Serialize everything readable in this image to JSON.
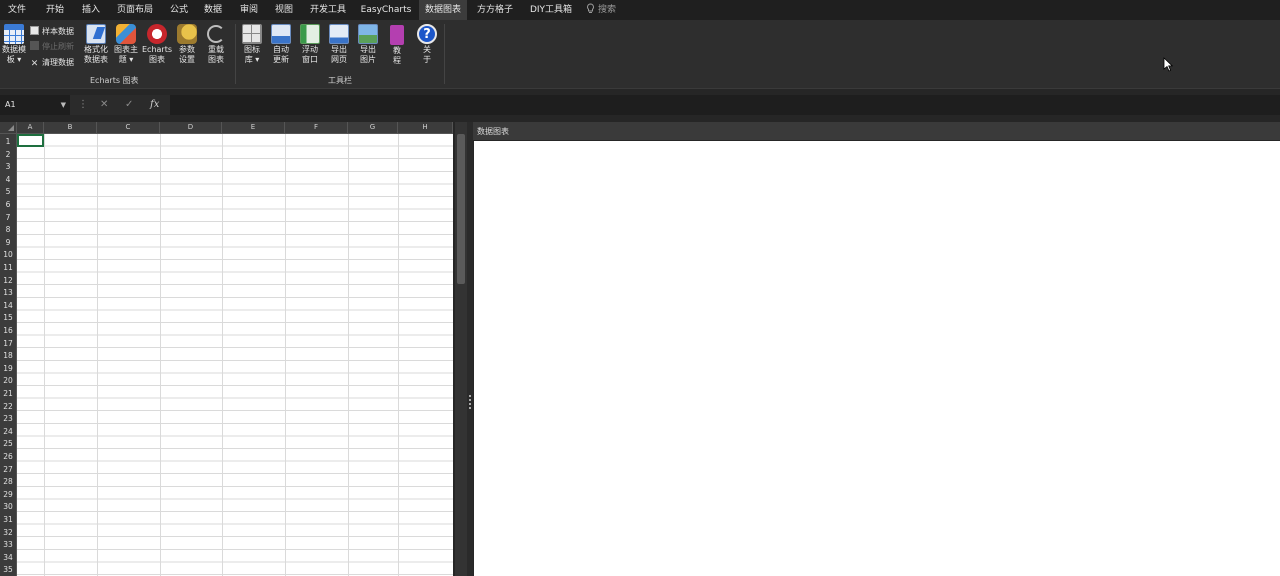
{
  "tabs": [
    {
      "label": "文件",
      "active": false
    },
    {
      "label": "开始",
      "active": false
    },
    {
      "label": "插入",
      "active": false
    },
    {
      "label": "页面布局",
      "active": false
    },
    {
      "label": "公式",
      "active": false
    },
    {
      "label": "数据",
      "active": false
    },
    {
      "label": "审阅",
      "active": false
    },
    {
      "label": "视图",
      "active": false
    },
    {
      "label": "开发工具",
      "active": false
    },
    {
      "label": "EasyCharts",
      "active": false
    },
    {
      "label": "数据图表",
      "active": true
    },
    {
      "label": "方方格子",
      "active": false
    },
    {
      "label": "DIY工具箱",
      "active": false
    }
  ],
  "search": {
    "placeholder": "搜索"
  },
  "ribbon": {
    "data_template": {
      "label1": "数据模",
      "label2": "板 ▾"
    },
    "small": {
      "sample_data": "样本数据",
      "stop_refresh": "停止刷新",
      "clear_data": "清理数据"
    },
    "group1_buttons": [
      {
        "l1": "格式化",
        "l2": "数据表"
      },
      {
        "l1": "图表主",
        "l2": "题 ▾"
      },
      {
        "l1": "Echarts",
        "l2": "图表"
      },
      {
        "l1": "参数",
        "l2": "设置"
      },
      {
        "l1": "重载",
        "l2": "图表"
      }
    ],
    "group1_label": "Echarts 图表",
    "group2_buttons": [
      {
        "l1": "图标",
        "l2": "库 ▾"
      },
      {
        "l1": "自动",
        "l2": "更新"
      },
      {
        "l1": "浮动",
        "l2": "窗口"
      },
      {
        "l1": "导出",
        "l2": "网页"
      },
      {
        "l1": "导出",
        "l2": "图片"
      },
      {
        "l1": "教",
        "l2": "程"
      },
      {
        "l1": "关",
        "l2": "于"
      }
    ],
    "group2_label": "工具栏"
  },
  "formula_bar": {
    "name_box": "A1",
    "formula": ""
  },
  "sheet": {
    "columns": [
      "A",
      "B",
      "C",
      "D",
      "E",
      "F",
      "G",
      "H"
    ],
    "rows": [
      "1",
      "2",
      "3",
      "4",
      "5",
      "6",
      "7",
      "8",
      "9",
      "10",
      "11",
      "12",
      "13",
      "14",
      "15",
      "16",
      "17",
      "18",
      "19",
      "20",
      "21",
      "22",
      "23",
      "24",
      "25",
      "26",
      "27",
      "28",
      "29",
      "30",
      "31",
      "32",
      "33",
      "34",
      "35"
    ]
  },
  "pane": {
    "title": "数据图表"
  },
  "colors": {
    "accent": "#1e6f3f",
    "ribbon_bg": "#2e2e2e",
    "tabbar_bg": "#1f1f1f"
  }
}
